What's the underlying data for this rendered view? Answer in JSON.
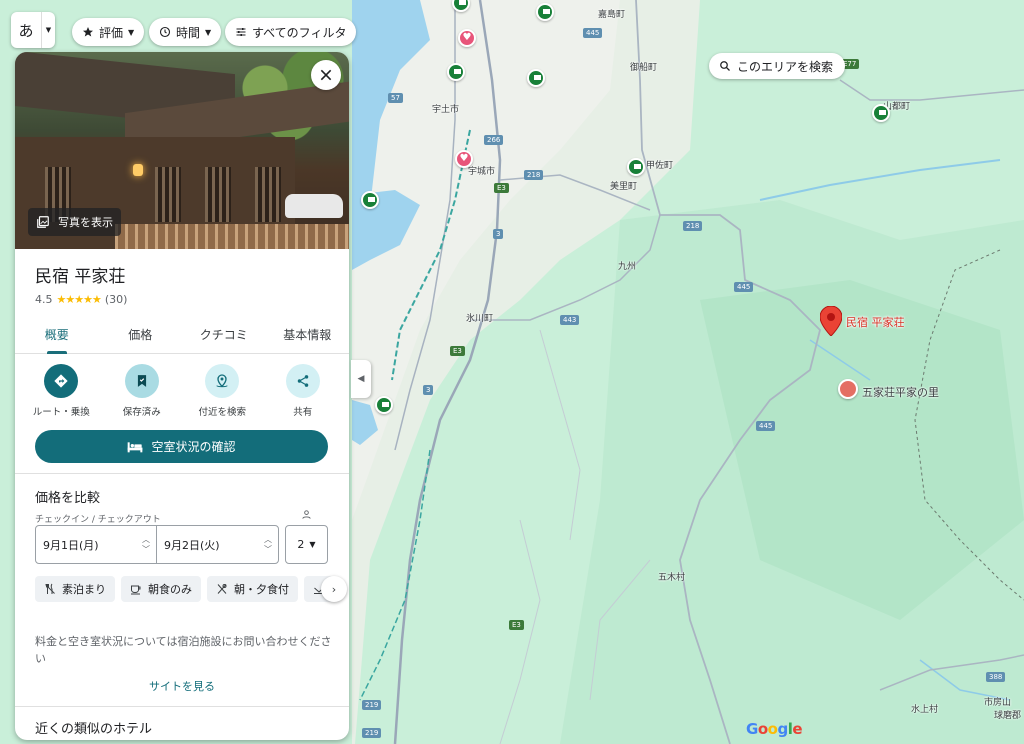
{
  "topbar": {
    "lang_char": "あ",
    "filters": [
      {
        "label": "評価",
        "icon": "star-icon"
      },
      {
        "label": "時間",
        "icon": "clock-icon"
      },
      {
        "label": "すべてのフィルタ",
        "icon": "tune-icon"
      }
    ]
  },
  "map": {
    "search_area_label": "このエリアを検索",
    "place_labels": [
      "嘉島町",
      "御船町",
      "山都町",
      "宇土市",
      "宇城市",
      "甲佐町",
      "美里町",
      "九州",
      "氷川町",
      "五木村",
      "水上村",
      "市房山",
      "球磨郡"
    ],
    "route_shields": [
      "445",
      "57",
      "266",
      "218",
      "218",
      "445",
      "443",
      "445",
      "388",
      "219",
      "3",
      "3",
      "219"
    ],
    "expressway_shields": [
      "E77",
      "E3",
      "E3",
      "E3"
    ],
    "main_pin_label": "民宿 平家荘",
    "sub_pin_label": "五家荘平家の里",
    "logo": "Google"
  },
  "panel": {
    "photo_button": "写真を表示",
    "title": "民宿 平家荘",
    "rating": "4.5",
    "stars_value": 4.5,
    "review_count": "(30)",
    "tabs": [
      "概要",
      "価格",
      "クチコミ",
      "基本情報"
    ],
    "active_tab": 0,
    "actions": [
      {
        "label": "ルート・乗換",
        "icon": "directions-icon"
      },
      {
        "label": "保存済み",
        "icon": "bookmark-icon"
      },
      {
        "label": "付近を検索",
        "icon": "nearby-icon"
      },
      {
        "label": "共有",
        "icon": "share-icon"
      }
    ],
    "availability_button": "空室状況の確認",
    "compare_title": "価格を比較",
    "date_caption": "チェックイン / チェックアウト",
    "checkin": "9月1日(月)",
    "checkout": "9月2日(火)",
    "guests": "2",
    "meal_options": [
      "素泊まり",
      "朝食のみ",
      "朝・夕食付"
    ],
    "info_text": "料金と空き室状況については宿泊施設にお問い合わせください",
    "site_link": "サイトを見る",
    "similar_title": "近くの類似のホテル"
  }
}
